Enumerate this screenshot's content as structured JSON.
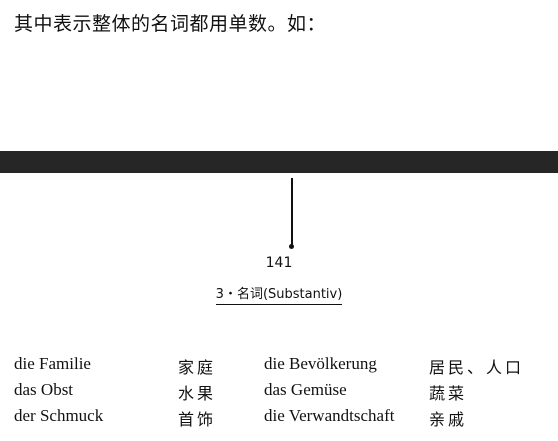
{
  "intro_text": "其中表示整体的名词都用单数。如：",
  "page_number": "141",
  "running_header": "3・名词(Substantiv)",
  "vocabulary": [
    {
      "german_1": "die Familie",
      "chinese_1": "家庭",
      "german_2": "die Bevölkerung",
      "chinese_2": "居民、人口"
    },
    {
      "german_1": "das Obst",
      "chinese_1": "水果",
      "german_2": "das Gemüse",
      "chinese_2": "蔬菜"
    },
    {
      "german_1": "der Schmuck",
      "chinese_1": "首饰",
      "german_2": "die Verwandtschaft",
      "chinese_2": "亲戚"
    }
  ]
}
